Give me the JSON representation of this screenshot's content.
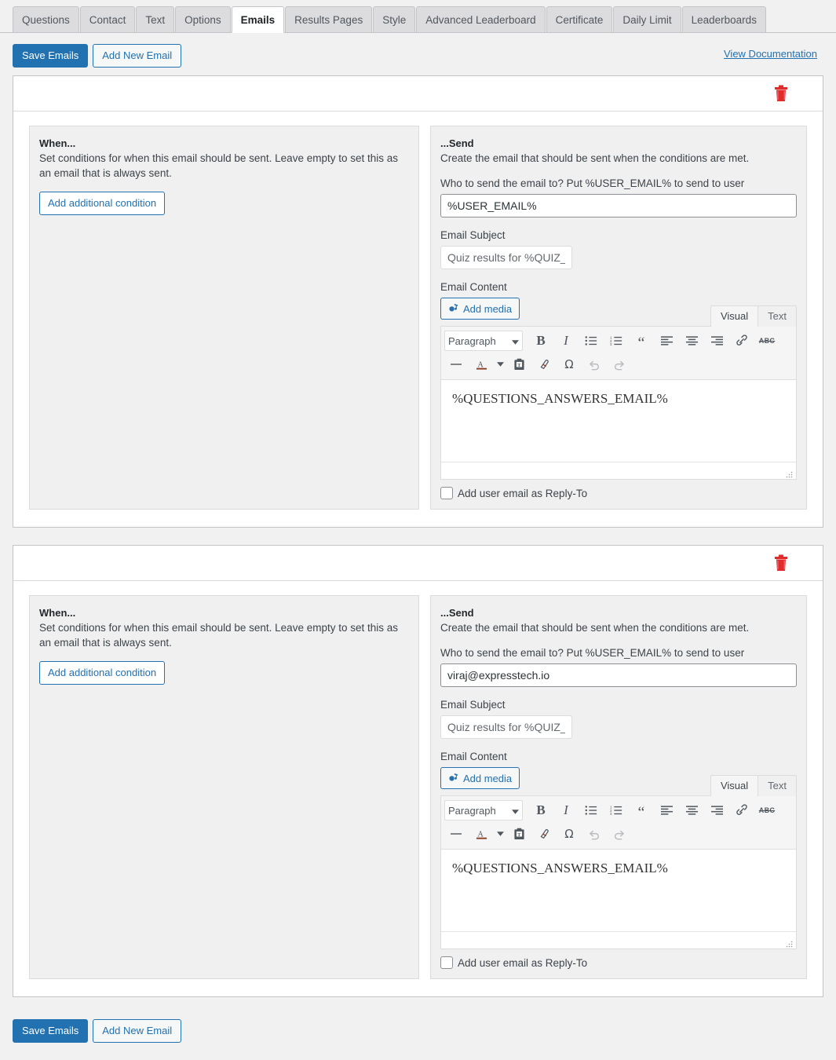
{
  "tabs": [
    {
      "label": "Questions",
      "active": false
    },
    {
      "label": "Contact",
      "active": false
    },
    {
      "label": "Text",
      "active": false
    },
    {
      "label": "Options",
      "active": false
    },
    {
      "label": "Emails",
      "active": true
    },
    {
      "label": "Results Pages",
      "active": false
    },
    {
      "label": "Style",
      "active": false
    },
    {
      "label": "Advanced Leaderboard",
      "active": false
    },
    {
      "label": "Certificate",
      "active": false
    },
    {
      "label": "Daily Limit",
      "active": false
    },
    {
      "label": "Leaderboards",
      "active": false
    }
  ],
  "toolbar": {
    "save_label": "Save Emails",
    "add_new_label": "Add New Email",
    "doc_link_label": "View Documentation"
  },
  "footer": {
    "save_label": "Save Emails",
    "add_new_label": "Add New Email"
  },
  "labels": {
    "when_title": "When...",
    "when_desc": "Set conditions for when this email should be sent. Leave empty to set this as an email that is always sent.",
    "add_condition": "Add additional condition",
    "send_title": "...Send",
    "send_desc": "Create the email that should be sent when the conditions are met.",
    "recipient_label": "Who to send the email to? Put %USER_EMAIL% to send to user",
    "subject_label": "Email Subject",
    "content_label": "Email Content",
    "add_media": "Add media",
    "visual_tab": "Visual",
    "text_tab": "Text",
    "paragraph_select": "Paragraph",
    "replyto_label": "Add user email as Reply-To",
    "trash_title": "Delete email"
  },
  "editor_toolbar": {
    "row1": [
      "bold",
      "italic",
      "bulleted-list",
      "numbered-list",
      "blockquote",
      "align-left",
      "align-center",
      "align-right",
      "link",
      "strikethrough"
    ],
    "row2": [
      "horizontal-rule",
      "text-color",
      "text-color-dropdown",
      "paste-as-text",
      "clear-formatting",
      "special-character",
      "undo",
      "redo"
    ]
  },
  "emails": [
    {
      "recipient_value": "%USER_EMAIL%",
      "subject_placeholder": "Quiz results for %QUIZ_NAME%",
      "subject_value": "Quiz results for %QUIZ_!",
      "content_value": "%QUESTIONS_ANSWERS_EMAIL%",
      "replyto_checked": false,
      "editor_active_tab": "Visual"
    },
    {
      "recipient_value": "viraj@expresstech.io",
      "subject_placeholder": "Quiz results for %QUIZ_NAME%",
      "subject_value": "Quiz results for %QUIZ_!",
      "content_value": "%QUESTIONS_ANSWERS_EMAIL%",
      "replyto_checked": false,
      "editor_active_tab": "Visual"
    }
  ],
  "colors": {
    "accent": "#2271b1",
    "danger": "#e02b2b",
    "page_bg": "#f1f1f1",
    "panel_bg": "#ffffff",
    "inner_bg": "#f0f0f0"
  }
}
